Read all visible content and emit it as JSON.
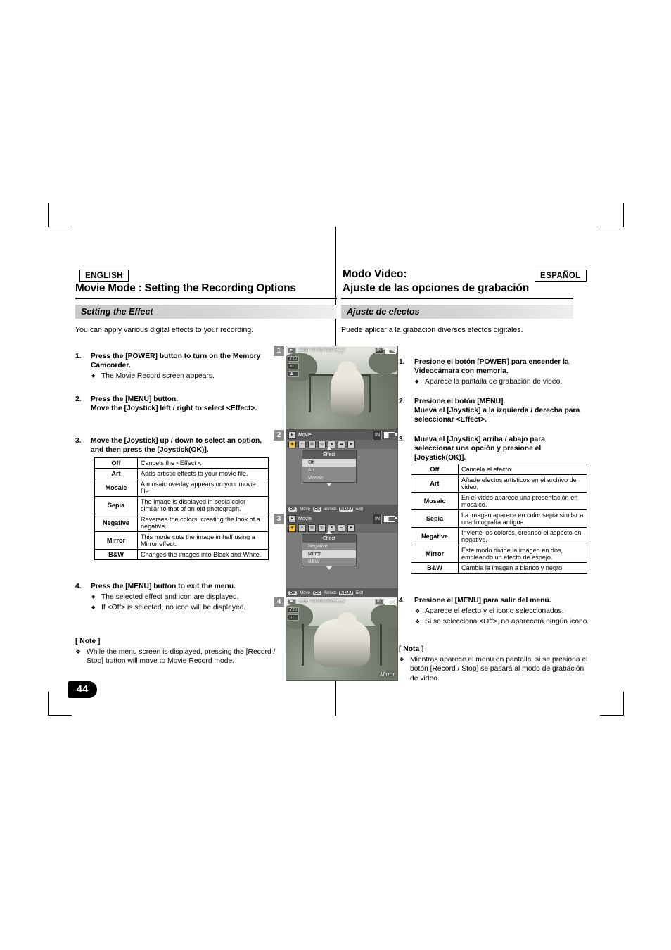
{
  "language_tags": {
    "english": "ENGLISH",
    "spanish": "ESPAÑOL"
  },
  "titles": {
    "english": "Movie Mode : Setting the Recording Options",
    "spanish_line1": "Modo Video:",
    "spanish_line2": "Ajuste de las opciones de grabación"
  },
  "sections": {
    "english_heading": "Setting the Effect",
    "spanish_heading": "Ajuste de efectos",
    "english_lead": "You can apply various digital effects to your recording.",
    "spanish_lead": "Puede aplicar a la grabación diversos efectos digitales."
  },
  "english_steps": [
    {
      "num": "1.",
      "text": "Press the [POWER] button to turn on the Memory Camcorder.",
      "bullets": [
        "The Movie Record screen appears."
      ]
    },
    {
      "num": "2.",
      "text": "Press the [MENU] button.\nMove the [Joystick] left / right to select <Effect>.",
      "bullets": []
    },
    {
      "num": "3.",
      "text": "Move the [Joystick] up / down to select an option, and then press the [Joystick(OK)].",
      "bullets": []
    },
    {
      "num": "4.",
      "text": "Press the [MENU] button to exit the menu.",
      "bullets": [
        "The selected effect and icon are displayed.",
        "If <Off> is selected, no icon will be displayed."
      ]
    }
  ],
  "spanish_steps": [
    {
      "num": "1.",
      "text": "Presione el botón [POWER] para encender la Videocámara con memoria.",
      "bullets": [
        "Aparece la pantalla de grabación de video."
      ]
    },
    {
      "num": "2.",
      "text": "Presione el botón [MENU].\nMueva el [Joystick] a la izquierda / derecha para seleccionar <Effect>.",
      "bullets": []
    },
    {
      "num": "3.",
      "text": "Mueva el [Joystick] arriba / abajo para seleccionar una opción y presione el [Joystick(OK)].",
      "bullets": []
    },
    {
      "num": "4.",
      "text": "Presione el [MENU] para salir del menú.",
      "bullets": [
        "Aparece el efecto y el icono seleccionados.",
        "Si se selecciona <Off>, no aparecerá ningún icono."
      ]
    }
  ],
  "english_table": {
    "rows": [
      {
        "key": "Off",
        "desc": "Cancels the <Effect>."
      },
      {
        "key": "Art",
        "desc": "Adds artistic effects to your movie file."
      },
      {
        "key": "Mosaic",
        "desc": "A mosaic overlay appears on your movie file."
      },
      {
        "key": "Sepia",
        "desc": "The image is displayed in sepia color similar to that of an old photograph."
      },
      {
        "key": "Negative",
        "desc": "Reverses the colors, creating the look of a negative."
      },
      {
        "key": "Mirror",
        "desc": "This mode cuts the image in half using a Mirror effect."
      },
      {
        "key": "B&W",
        "desc": "Changes the images into Black and White."
      }
    ]
  },
  "spanish_table": {
    "rows": [
      {
        "key": "Off",
        "desc": "Cancela el efecto."
      },
      {
        "key": "Art",
        "desc": "Añade efectos artísticos en el archivo de video."
      },
      {
        "key": "Mosaic",
        "desc": "En el video aparece una presentación en mosaico."
      },
      {
        "key": "Sepia",
        "desc": "La imagen aparece en color sepia similar a una fotografía antigua."
      },
      {
        "key": "Negative",
        "desc": "Invierte los colores, creando el aspecto en negativo."
      },
      {
        "key": "Mirror",
        "desc": "Este modo divide la imagen en dos, empleando un efecto de espejo."
      },
      {
        "key": "B&W",
        "desc": "Cambia la imagen a blanco y negro"
      }
    ]
  },
  "notes": {
    "english_header": "[ Note ]",
    "english_items": [
      "While the menu screen is displayed, pressing the [Record / Stop] button will move to Movie Record mode."
    ],
    "spanish_header": "[ Nota ]",
    "spanish_items": [
      "Mientras aparece el menú en pantalla, si se presiona el botón [Record / Stop] se pasará al modo de grabación de video."
    ]
  },
  "page_number": "44",
  "screens": {
    "s1": {
      "badge": "1",
      "osd_time": "-STBY 00:00:00/00:56:12",
      "osd_mem": "IN",
      "osd_icons": [
        "720",
        "settings-icon",
        "person-icon"
      ]
    },
    "s2": {
      "badge": "2",
      "title": "Movie",
      "mem": "IN",
      "panel_title": "Effect",
      "items": [
        {
          "label": "Off",
          "selected": true
        },
        {
          "label": "Art",
          "selected": false
        },
        {
          "label": "Mosaic",
          "selected": false
        }
      ],
      "bottom": [
        {
          "key": "OK",
          "label": "Move"
        },
        {
          "key": "OK",
          "label": "Select"
        },
        {
          "key": "MENU",
          "label": "Exit"
        }
      ]
    },
    "s3": {
      "badge": "3",
      "title": "Movie",
      "mem": "IN",
      "panel_title": "Effect",
      "items": [
        {
          "label": "Negative",
          "selected": false
        },
        {
          "label": "Mirror",
          "selected": true
        },
        {
          "label": "B&W",
          "selected": false
        }
      ],
      "bottom": [
        {
          "key": "OK",
          "label": "Move"
        },
        {
          "key": "OK",
          "label": "Select"
        },
        {
          "key": "MENU",
          "label": "Exit"
        }
      ]
    },
    "s4": {
      "badge": "4",
      "osd_time": "-STBY 00:00:00/00:56:12",
      "osd_mem": "IN",
      "effect_label": "Mirror"
    }
  }
}
